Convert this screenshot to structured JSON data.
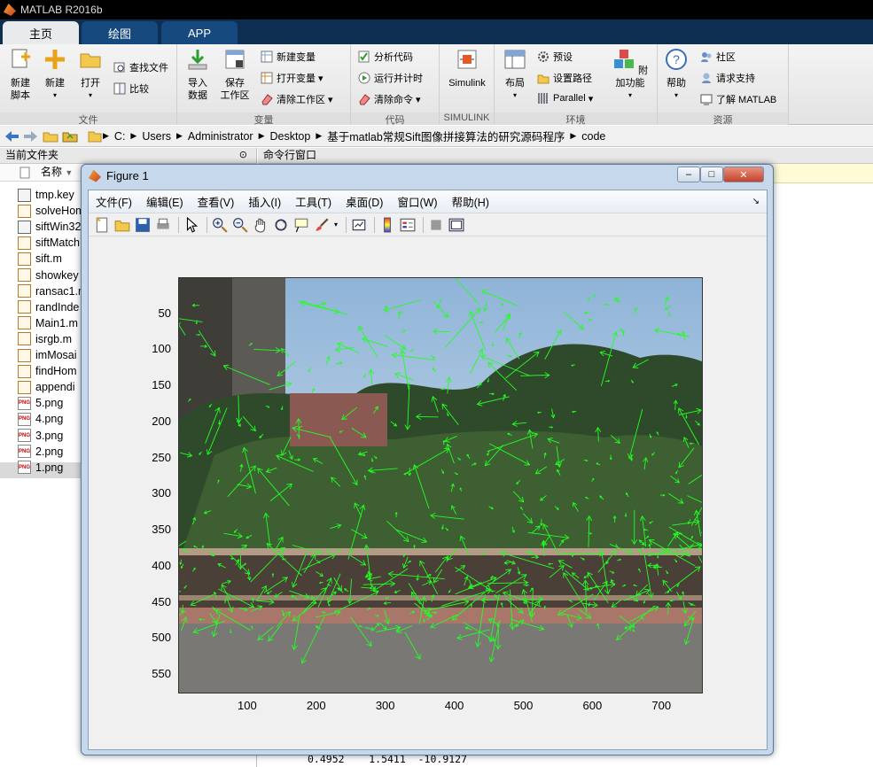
{
  "app": {
    "title": "MATLAB R2016b"
  },
  "tabs": [
    "主页",
    "绘图",
    "APP"
  ],
  "ribbon": {
    "file_group": {
      "label": "文件",
      "new_script": [
        "新建",
        "脚本"
      ],
      "new": "新建",
      "open": "打开",
      "find_files": "查找文件",
      "compare": "比较"
    },
    "variable_group": {
      "label": "变量",
      "import": [
        "导入",
        "数据"
      ],
      "save": [
        "保存",
        "工作区"
      ],
      "new_variable": "新建变量",
      "open_variable": "打开变量",
      "clear_workspace": "清除工作区"
    },
    "code_group": {
      "label": "代码",
      "analyze": "分析代码",
      "run_time": "运行并计时",
      "clear_commands": "清除命令"
    },
    "simulink_group": {
      "label": "SIMULINK",
      "simulink": "Simulink"
    },
    "env_group": {
      "label": "环境",
      "layout": "布局",
      "preferences": "预设",
      "set_path": "设置路径",
      "parallel": "Parallel",
      "addons": "附加功能"
    },
    "resources_group": {
      "label": "资源",
      "help": "帮助",
      "community": "社区",
      "support": "请求支持",
      "learn": "了解 MATLAB"
    }
  },
  "address": {
    "crumbs": [
      "C:",
      "Users",
      "Administrator",
      "Desktop",
      "基于matlab常规Sift图像拼接算法的研究源码程序",
      "code"
    ]
  },
  "current_folder": {
    "title": "当前文件夹",
    "name_col": "名称",
    "files": [
      {
        "name": "tmp.key",
        "type": "key"
      },
      {
        "name": "solveHom",
        "type": "m"
      },
      {
        "name": "siftWin32",
        "type": "key"
      },
      {
        "name": "siftMatch",
        "type": "m"
      },
      {
        "name": "sift.m",
        "type": "m"
      },
      {
        "name": "showkey",
        "type": "m"
      },
      {
        "name": "ransac1.m",
        "type": "m"
      },
      {
        "name": "randInde",
        "type": "m"
      },
      {
        "name": "Main1.m",
        "type": "m"
      },
      {
        "name": "isrgb.m",
        "type": "m"
      },
      {
        "name": "imMosai",
        "type": "m"
      },
      {
        "name": "findHom",
        "type": "m"
      },
      {
        "name": "appendi",
        "type": "m"
      },
      {
        "name": "5.png",
        "type": "png"
      },
      {
        "name": "4.png",
        "type": "png"
      },
      {
        "name": "3.png",
        "type": "png"
      },
      {
        "name": "2.png",
        "type": "png"
      },
      {
        "name": "1.png",
        "type": "png"
      }
    ]
  },
  "command_window": {
    "title": "命令行窗口",
    "output": "0.4952    1.5411  -10.9127"
  },
  "figure": {
    "title": "Figure 1",
    "window_buttons": {
      "minimize": "‒",
      "restore": "□",
      "close": "✕"
    },
    "menu": [
      "文件(F)",
      "编辑(E)",
      "查看(V)",
      "插入(I)",
      "工具(T)",
      "桌面(D)",
      "窗口(W)",
      "帮助(H)"
    ],
    "x_ticks": [
      "100",
      "200",
      "300",
      "400",
      "500",
      "600",
      "700"
    ],
    "y_ticks": [
      "50",
      "100",
      "150",
      "200",
      "250",
      "300",
      "350",
      "400",
      "450",
      "500",
      "550"
    ],
    "vector_color": "#22ff22"
  }
}
